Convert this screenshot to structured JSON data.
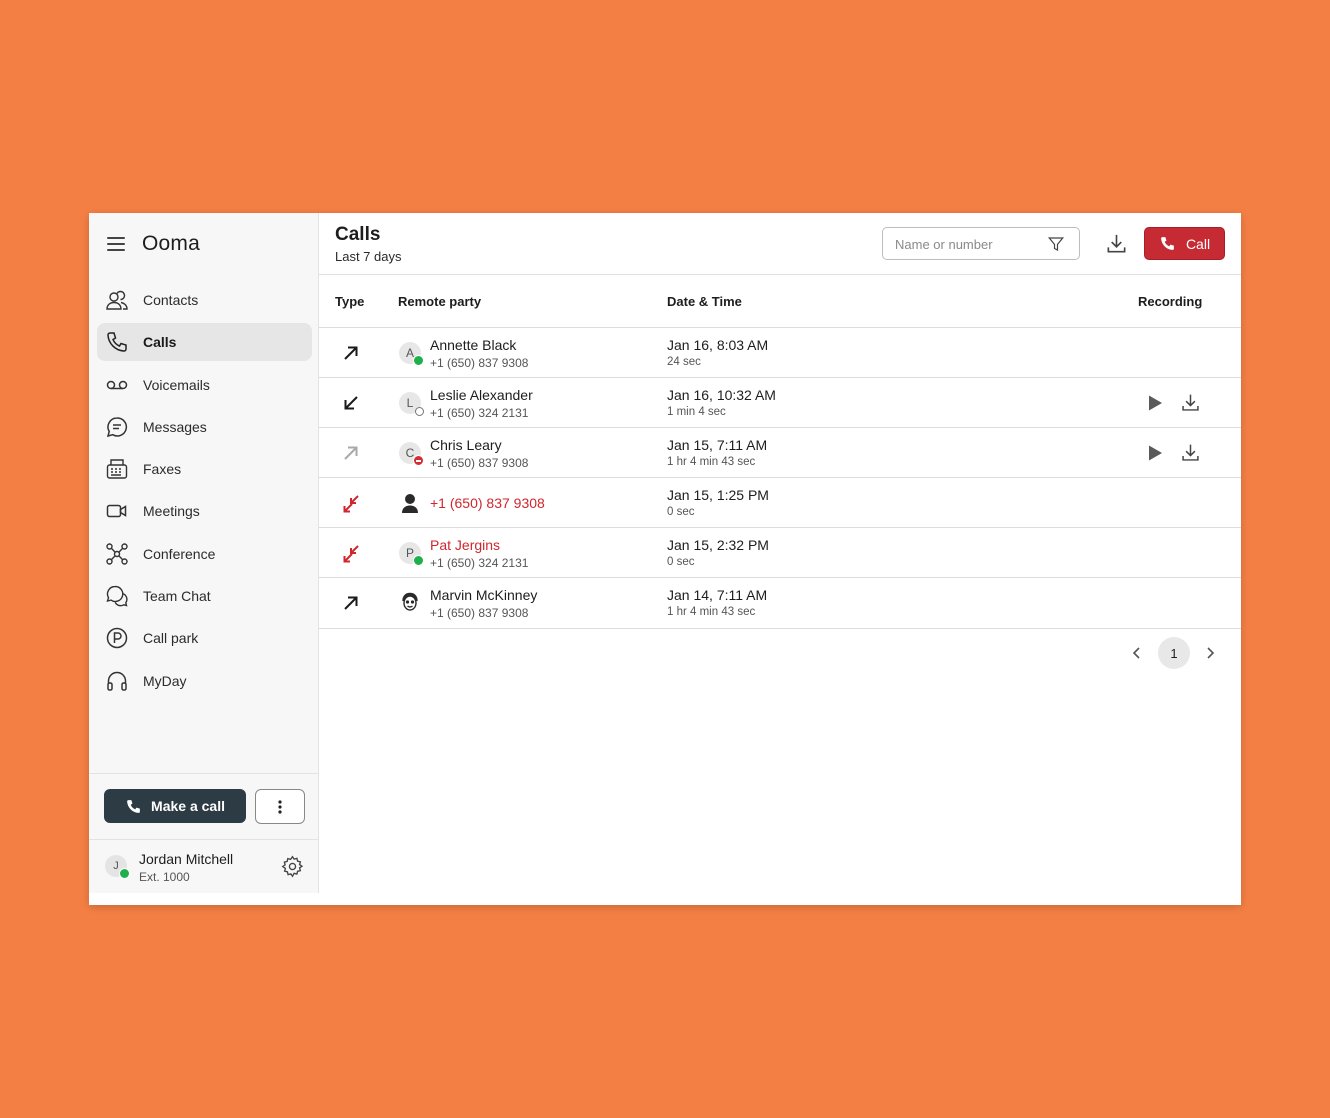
{
  "app": {
    "brand": "Ooma"
  },
  "sidebar": {
    "items": [
      {
        "label": "Contacts",
        "icon": "contacts-icon"
      },
      {
        "label": "Calls",
        "icon": "phone-icon",
        "active": true
      },
      {
        "label": "Voicemails",
        "icon": "voicemail-icon"
      },
      {
        "label": "Messages",
        "icon": "message-icon"
      },
      {
        "label": "Faxes",
        "icon": "fax-icon"
      },
      {
        "label": "Meetings",
        "icon": "video-icon"
      },
      {
        "label": "Conference",
        "icon": "conference-icon"
      },
      {
        "label": "Team Chat",
        "icon": "chat-bubbles-icon"
      },
      {
        "label": "Call park",
        "icon": "parking-icon"
      },
      {
        "label": "MyDay",
        "icon": "headset-icon"
      }
    ],
    "make_call_label": "Make a call",
    "user": {
      "initial": "J",
      "name": "Jordan Mitchell",
      "ext": "Ext. 1000",
      "status": "online"
    }
  },
  "header": {
    "title": "Calls",
    "subtitle": "Last 7 days",
    "search_placeholder": "Name or number",
    "call_label": "Call"
  },
  "table": {
    "columns": {
      "type": "Type",
      "remote": "Remote party",
      "datetime": "Date & Time",
      "recording": "Recording"
    },
    "rows": [
      {
        "type": "outgoing",
        "initial": "A",
        "status": "online",
        "name": "Annette Black",
        "number": "+1 (650) 837 9308",
        "date": "Jan 16, 8:03 AM",
        "duration": "24 sec",
        "recording": false
      },
      {
        "type": "incoming",
        "initial": "L",
        "status": "offline",
        "name": "Leslie Alexander",
        "number": "+1 (650) 324 2131",
        "date": "Jan 16, 10:32 AM",
        "duration": "1 min 4 sec",
        "recording": true
      },
      {
        "type": "outgoing-unanswered",
        "initial": "C",
        "status": "dnd",
        "name": "Chris Leary",
        "number": "+1 (650) 837 9308",
        "date": "Jan 15, 7:11 AM",
        "duration": "1 hr 4 min 43 sec",
        "recording": true
      },
      {
        "type": "missed",
        "initial": "",
        "status": "unknown",
        "name": "",
        "number": "+1 (650) 837 9308",
        "date": "Jan 15, 1:25 PM",
        "duration": "0 sec",
        "recording": false
      },
      {
        "type": "missed",
        "initial": "P",
        "status": "online",
        "name": "Pat Jergins",
        "number": "+1 (650) 324 2131",
        "date": "Jan 15, 2:32 PM",
        "duration": "0 sec",
        "recording": false
      },
      {
        "type": "outgoing",
        "initial": "",
        "status": "photo",
        "name": "Marvin McKinney",
        "number": "+1 (650) 837 9308",
        "date": "Jan 14, 7:11 AM",
        "duration": "1 hr 4 min 43 sec",
        "recording": false
      }
    ]
  },
  "pagination": {
    "current": "1"
  },
  "colors": {
    "background": "#F47F44",
    "accent": "#C62A33",
    "missed": "#D0262E",
    "online": "#20B04B",
    "dark_button": "#2D3B45"
  }
}
